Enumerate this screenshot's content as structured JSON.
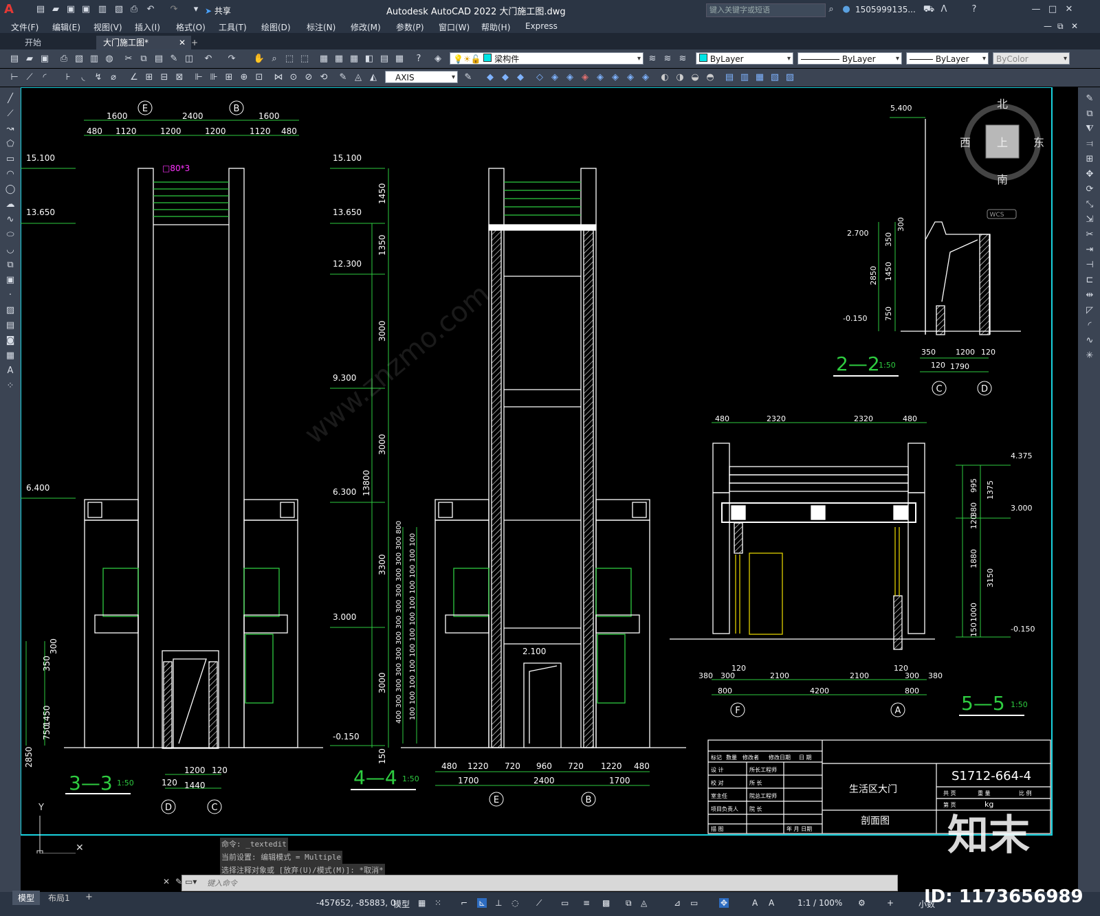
{
  "window": {
    "title": "Autodesk AutoCAD 2022    大门施工图.dwg",
    "share": "共享",
    "search_placeholder": "键入关键字或短语",
    "user": "1505999135...",
    "express": "Express"
  },
  "menu": [
    "文件(F)",
    "编辑(E)",
    "视图(V)",
    "插入(I)",
    "格式(O)",
    "工具(T)",
    "绘图(D)",
    "标注(N)",
    "修改(M)",
    "参数(P)",
    "窗口(W)",
    "帮助(H)",
    "Express"
  ],
  "tabs": {
    "start": "开始",
    "doc": "大门施工图*",
    "add": "+"
  },
  "toolbar": {
    "layer": "梁构件",
    "color": "ByLayer",
    "linetype": "ByLayer",
    "lineweight": "ByLayer",
    "plotstyle": "ByColor",
    "dimstyle": "AXIS"
  },
  "compass": {
    "north": "北",
    "south": "南",
    "east": "东",
    "west": "西",
    "top": "上",
    "wcs": "WCS"
  },
  "drawing": {
    "sec33": {
      "label": "3—3",
      "scale": "1:50"
    },
    "sec44": {
      "label": "4—4",
      "scale": "1:50"
    },
    "sec22": {
      "label": "2—2",
      "scale": "1:50"
    },
    "sec55": {
      "label": "5—5",
      "scale": "1:50"
    },
    "axis": {
      "E": "E",
      "B": "B",
      "D": "D",
      "C": "C",
      "F": "F",
      "A": "A"
    },
    "dims33_top1": [
      "1600",
      "2400",
      "1600"
    ],
    "dims33_top2": [
      "480",
      "1120",
      "1200",
      "1200",
      "1120",
      "480"
    ],
    "dims33_bot": [
      "1200",
      "120",
      "120",
      "1440"
    ],
    "dims33_left": [
      "300",
      "350",
      "2850",
      "1450",
      "750"
    ],
    "dims44_bot1": [
      "480",
      "1220",
      "720",
      "960",
      "720",
      "1220",
      "480"
    ],
    "dims44_bot2": [
      "1700",
      "2400",
      "1700"
    ],
    "dims44_vert": [
      "1450",
      "1350",
      "3000",
      "3000",
      "13800",
      "3300",
      "3000",
      "150"
    ],
    "dims44_rows": [
      "800",
      "300",
      "300",
      "300",
      "300",
      "300",
      "300",
      "300",
      "300",
      "300",
      "300",
      "300",
      "400"
    ],
    "dims44_rows2": [
      "100",
      "100",
      "100",
      "100",
      "100",
      "100",
      "100",
      "100",
      "100",
      "100",
      "100",
      "100"
    ],
    "elevs_left": [
      "15.100",
      "13.650",
      "6.400"
    ],
    "elevs_mid": [
      "15.100",
      "13.650",
      "12.300",
      "9.300",
      "6.300",
      "3.000",
      "-0.150"
    ],
    "elev_door": "2.100",
    "rebar": "□80*3",
    "dims22_top": "5.400",
    "dims22": [
      "2.700",
      "-0.150",
      "300",
      "350",
      "2850",
      "1450",
      "750",
      "350",
      "1200",
      "120",
      "120",
      "1790"
    ],
    "dims55_top": [
      "480",
      "2320",
      "2320",
      "480"
    ],
    "dims55_bot1": [
      "380",
      "300",
      "120",
      "2100",
      "2100",
      "120",
      "300",
      "380"
    ],
    "dims55_bot2": [
      "800",
      "4200",
      "800"
    ],
    "dims55_right": [
      "4.375",
      "3.000",
      "-0.150",
      "995",
      "1375",
      "380",
      "120",
      "1880",
      "3150",
      "1000",
      "150"
    ]
  },
  "titleblock": {
    "drawing_no": "S1712-664-4",
    "project": "生活区大门",
    "sheet": "剖面图",
    "rows_left": [
      "设 计",
      "校 对",
      "室主任",
      "项目负责人",
      "描 图"
    ],
    "rows_mid": [
      "所长工程师",
      "所 长",
      "院总工程师",
      "院 长",
      "年 月 日期"
    ],
    "hdr": [
      "标记",
      "数量",
      "修改者",
      "修改日期",
      "日 期"
    ],
    "right_hdr": [
      "共 页",
      "重 量",
      "比 例"
    ],
    "right_row2": [
      "第 页",
      "kg"
    ]
  },
  "command": {
    "line1": "命令: _textedit",
    "line2": "当前设置: 编辑模式 = Multiple",
    "line3": "选择注释对象或 [放弃(U)/模式(M)]: *取消*",
    "placeholder": "键入命令"
  },
  "status": {
    "model_tab": "模型",
    "layout_tab": "布局1",
    "add": "+",
    "coords": "-457652, -85883, 0",
    "mode": "模型",
    "scale": "1:1 / 100%",
    "units": "小数"
  },
  "watermark": {
    "brand": "知末",
    "id": "ID: 1173656989",
    "site": "www.znzmo.com"
  }
}
